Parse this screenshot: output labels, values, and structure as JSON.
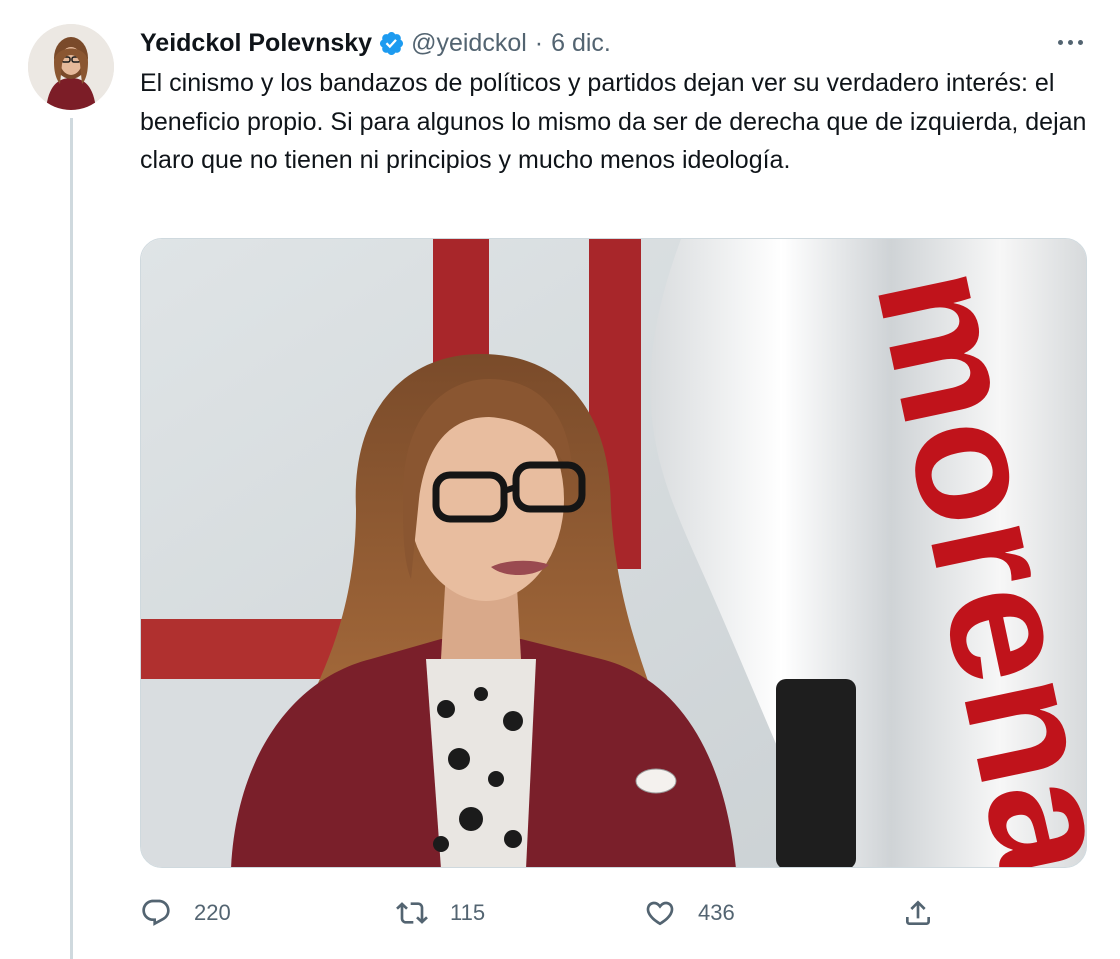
{
  "tweet": {
    "author": {
      "display_name": "Yeidckol Polevnsky",
      "handle": "@yeidckol",
      "verified": true
    },
    "separator": "·",
    "date": "6 dic.",
    "text": "El cinismo y los bandazos de políticos y partidos dejan ver su verdadero interés: el beneficio propio. Si para algunos lo mismo da ser de derecha que de izquierda, dejan claro que no tienen ni principios y mucho menos ideología.",
    "media": {
      "flag_text": "morena"
    },
    "actions": {
      "reply_count": "220",
      "retweet_count": "115",
      "like_count": "436"
    }
  },
  "icons": {
    "verified": "verified-badge-icon",
    "more": "more-dots-icon",
    "reply": "reply-icon",
    "retweet": "retweet-icon",
    "like": "heart-icon",
    "share": "share-icon"
  },
  "colors": {
    "text_primary": "#0f1419",
    "text_secondary": "#536471",
    "verified_blue": "#1d9bf0",
    "thread_line": "#cfd9de",
    "morena_red": "#b5111a"
  }
}
